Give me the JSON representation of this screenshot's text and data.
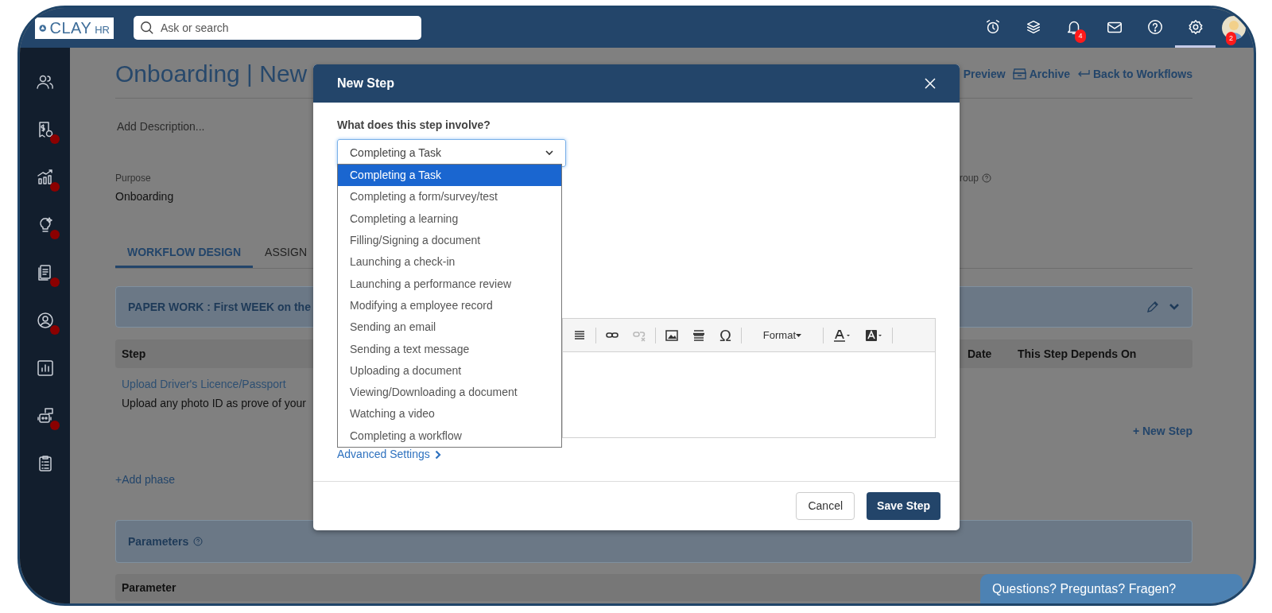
{
  "topbar": {
    "logo": {
      "text": "CLAY",
      "suffix": "HR"
    },
    "search": {
      "placeholder": "Ask or search"
    },
    "icons": [
      {
        "kind": "alarm",
        "selected": false
      },
      {
        "kind": "layers",
        "selected": false
      },
      {
        "kind": "bell",
        "badge": "4",
        "selected": false
      },
      {
        "kind": "mail",
        "selected": false
      },
      {
        "kind": "help",
        "selected": false
      },
      {
        "kind": "settings",
        "selected": true
      }
    ],
    "avatar": {
      "badge": "2"
    }
  },
  "sidebar": {
    "items": [
      {
        "kind": "people",
        "dot": false
      },
      {
        "kind": "payroll",
        "dot": true
      },
      {
        "kind": "growth",
        "dot": true
      },
      {
        "kind": "idea",
        "dot": true
      },
      {
        "kind": "documents",
        "dot": true
      },
      {
        "kind": "profile",
        "dot": true
      },
      {
        "kind": "report",
        "dot": false
      },
      {
        "kind": "bot",
        "dot": true
      },
      {
        "kind": "clipboard",
        "dot": false
      }
    ]
  },
  "page": {
    "title": "Onboarding | New",
    "actions": [
      {
        "label": "Preview"
      },
      {
        "kind": "archive",
        "label": "Archive"
      },
      {
        "kind": "back",
        "label": "Back to Workflows"
      }
    ],
    "description_placeholder": "Add Description...",
    "purpose": {
      "label": "Purpose",
      "value": "Onboarding"
    },
    "group_label": "roup",
    "tabs": [
      {
        "label": "WORKFLOW DESIGN",
        "selected": true
      },
      {
        "label": "ASSIGN",
        "selected": false
      }
    ],
    "phase": {
      "title": "PAPER WORK : First WEEK on the"
    },
    "steps_table": {
      "columns": [
        "Step",
        "Date",
        "This Step Depends On"
      ],
      "rows": [
        {
          "title": "Upload Driver's Licence/Passport",
          "description": "Upload any photo ID as prove of your"
        }
      ]
    },
    "new_step": "+ New Step",
    "add_phase": "+Add phase",
    "parameters": {
      "title": "Parameters",
      "columns": [
        "Parameter"
      ]
    }
  },
  "modal": {
    "title": "New Step",
    "question": "What does this step involve?",
    "select_value": "Completing a Task",
    "options": [
      {
        "label": "Completing a Task",
        "selected": true
      },
      {
        "label": "Completing a form/survey/test",
        "selected": false
      },
      {
        "label": "Completing a learning",
        "selected": false
      },
      {
        "label": "Filling/Signing a document",
        "selected": false
      },
      {
        "label": "Launching a check-in",
        "selected": false
      },
      {
        "label": "Launching a performance review",
        "selected": false
      },
      {
        "label": "Modifying a employee record",
        "selected": false
      },
      {
        "label": "Sending an email",
        "selected": false
      },
      {
        "label": "Sending a text message",
        "selected": false
      },
      {
        "label": "Uploading a document",
        "selected": false
      },
      {
        "label": "Viewing/Downloading a document",
        "selected": false
      },
      {
        "label": "Watching a video",
        "selected": false
      },
      {
        "label": "Completing a workflow",
        "selected": false
      }
    ],
    "toolbar": [
      {
        "kind": "justify",
        "disabled": false
      },
      {
        "kind": "link",
        "disabled": false
      },
      {
        "kind": "unlink",
        "disabled": true
      },
      {
        "kind": "image",
        "disabled": false
      },
      {
        "kind": "rule",
        "disabled": false
      },
      {
        "kind": "special",
        "label": "Ω",
        "disabled": false
      },
      {
        "kind": "format",
        "label": "Format",
        "disabled": false
      },
      {
        "kind": "text-color",
        "disabled": false
      },
      {
        "kind": "bg-color",
        "disabled": false
      }
    ],
    "advanced": "Advanced Settings",
    "cancel": "Cancel",
    "save": "Save Step"
  },
  "chat_button": "Questions? Preguntas? Fragen?"
}
